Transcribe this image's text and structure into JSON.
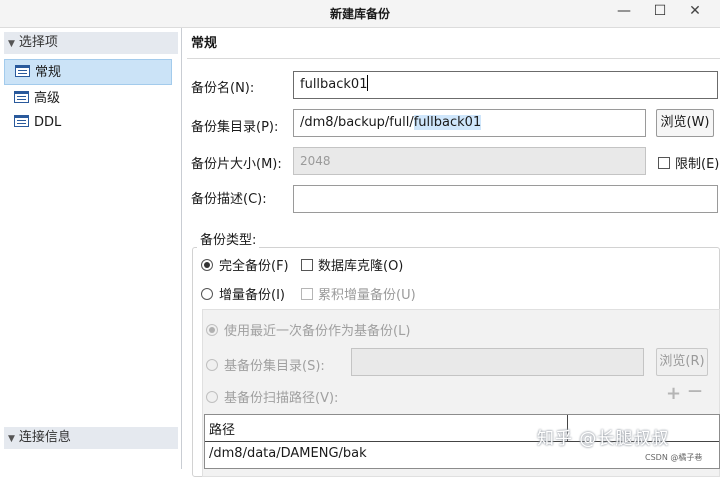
{
  "window": {
    "title": "新建库备份",
    "minimize": "—",
    "maximize": "☐",
    "close": "✕"
  },
  "sidebar": {
    "options_header": "选择项",
    "items": [
      {
        "label": "常规",
        "selected": true
      },
      {
        "label": "高级",
        "selected": false
      },
      {
        "label": "DDL",
        "selected": false
      }
    ],
    "connection_header": "连接信息"
  },
  "form": {
    "section_title": "常规",
    "backup_name_label": "备份名(N):",
    "backup_name_value": "fullback01",
    "backup_dir_label": "备份集目录(P):",
    "backup_dir_prefix": "/dm8/backup/full/",
    "backup_dir_selected": "fullback01",
    "browse_label": "浏览(W)",
    "piece_size_label": "备份片大小(M):",
    "piece_size_value": "2048",
    "limit_label": "限制(E)",
    "desc_label": "备份描述(C):",
    "desc_value": ""
  },
  "backup_type": {
    "group_label": "备份类型:",
    "full_label": "完全备份(F)",
    "full_selected": true,
    "clone_label": "数据库克隆(O)",
    "incremental_label": "增量备份(I)",
    "incremental_selected": false,
    "cumulative_label": "累积增量备份(U)",
    "use_recent_label": "使用最近一次备份作为基备份(L)",
    "base_dir_label": "基备份集目录(S):",
    "base_dir_value": "",
    "base_browse_label": "浏览(R)",
    "scan_path_label": "基备份扫描路径(V):",
    "add_symbol": "+",
    "remove_symbol": "—",
    "table_header": "路径",
    "table_rows": [
      "/dm8/data/DAMENG/bak"
    ]
  },
  "overlay": {
    "watermark": "知乎 @长腿叔叔",
    "csdn": "CSDN @橘子巷"
  }
}
